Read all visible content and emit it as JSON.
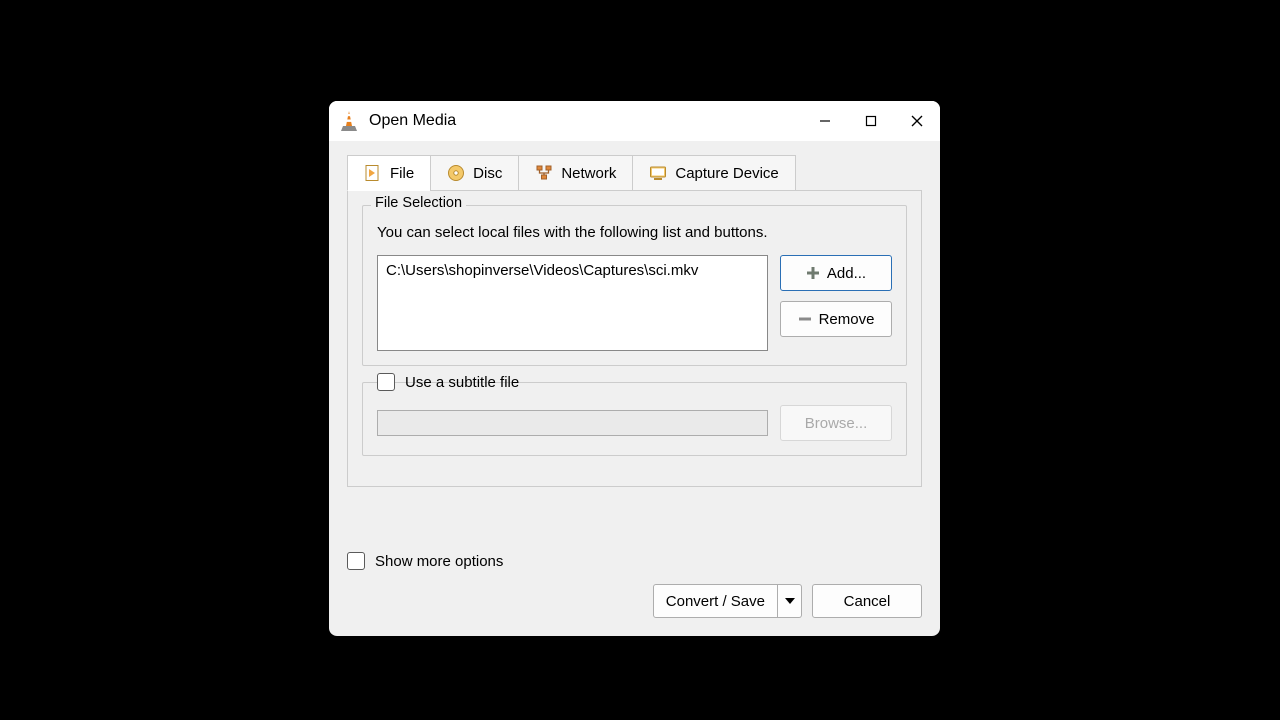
{
  "window": {
    "title": "Open Media"
  },
  "tabs": {
    "file": "File",
    "disc": "Disc",
    "network": "Network",
    "capture": "Capture Device"
  },
  "file_selection": {
    "legend": "File Selection",
    "help": "You can select local files with the following list and buttons.",
    "files": [
      "C:\\Users\\shopinverse\\Videos\\Captures\\sci.mkv"
    ],
    "add_label": "Add...",
    "remove_label": "Remove"
  },
  "subtitle": {
    "checkbox_label": "Use a subtitle file",
    "browse_label": "Browse..."
  },
  "show_more_label": "Show more options",
  "convert_label": "Convert / Save",
  "cancel_label": "Cancel"
}
